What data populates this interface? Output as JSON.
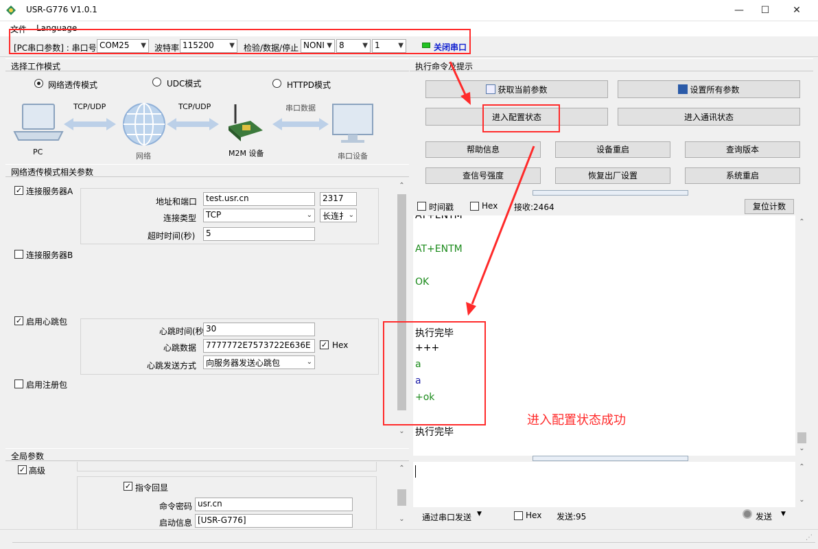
{
  "window": {
    "title": "USR-G776 V1.0.1",
    "minimize": "—",
    "maximize": "☐",
    "close": "✕"
  },
  "menu": [
    "文件",
    "Language"
  ],
  "portbar": {
    "params_label": "[PC串口参数] : 串口号",
    "port": "COM25",
    "baud_label": "波特率",
    "baud": "115200",
    "parity_label": "检验/数据/停止",
    "parity": "NONI",
    "databits": "8",
    "stopbits": "1",
    "close_port": "关闭串口",
    "status_color": "#22c322"
  },
  "mode": {
    "header": "选择工作模式",
    "options": [
      "网络透传模式",
      "UDC模式",
      "HTTPD模式"
    ],
    "selected": "网络透传模式",
    "diagram": {
      "pc": "PC",
      "net": "网络",
      "m2m": "M2M 设备",
      "serial": "串口设备",
      "link1": "TCP/UDP",
      "link2": "TCP/UDP",
      "link3": "串口数据"
    }
  },
  "net_params": {
    "header": "网络透传模式相关参数",
    "serverA": {
      "label": "连接服务器A",
      "checked": true,
      "addr_label": "地址和端口",
      "addr": "test.usr.cn",
      "port": "2317",
      "type_label": "连接类型",
      "type": "TCP",
      "conn": "长连扌",
      "timeout_label": "超时时间(秒)",
      "timeout": "5"
    },
    "serverB": {
      "label": "连接服务器B",
      "checked": false
    },
    "heartbeat": {
      "label": "启用心跳包",
      "checked": true,
      "time_label": "心跳时间(秒",
      "time": "30",
      "data_label": "心跳数据",
      "data": "7777772E7573722E636E",
      "hex_label": "Hex",
      "hex_checked": true,
      "mode_label": "心跳发送方式",
      "mode": "向服务器发送心跳包"
    },
    "register": {
      "label": "启用注册包",
      "checked": false
    }
  },
  "global": {
    "header": "全局参数",
    "advanced": "高级",
    "advanced_checked": true,
    "echo_label": "指令回显",
    "echo_checked": true,
    "pwd_label": "命令密码",
    "pwd": "usr.cn",
    "boot_label": "启动信息",
    "boot": "[USR-G776]"
  },
  "commands": {
    "header": "执行命令及提示",
    "get_params": "获取当前参数",
    "set_params": "设置所有参数",
    "enter_config": "进入配置状态",
    "enter_comm": "进入通讯状态",
    "help": "帮助信息",
    "reboot_dev": "设备重启",
    "query_ver": "查询版本",
    "signal": "查信号强度",
    "factory": "恢复出厂设置",
    "sys_reboot": "系统重启"
  },
  "recv": {
    "timestamp_label": "时间戳",
    "hex_label": "Hex",
    "count": "接收:2464",
    "reset": "复位计数",
    "lines": [
      {
        "text": "AT+ENTM",
        "color": "#000000"
      },
      {
        "text": "AT+ENTM",
        "color": "#1a8a1a"
      },
      {
        "text": "OK",
        "color": "#1a8a1a"
      },
      {
        "text": "执行完毕",
        "color": "#000000"
      },
      {
        "text": "+++",
        "color": "#000000"
      },
      {
        "text": "a",
        "color": "#1a8a1a"
      },
      {
        "text": "a",
        "color": "#1a1aa8"
      },
      {
        "text": "+ok",
        "color": "#1a8a1a"
      },
      {
        "text": "执行完毕",
        "color": "#000000"
      }
    ]
  },
  "send": {
    "via": "通过串口发送",
    "hex_label": "Hex",
    "count": "发送:95",
    "send_btn": "发送"
  },
  "annotation": {
    "text": "进入配置状态成功",
    "color": "#ff2a2a"
  }
}
